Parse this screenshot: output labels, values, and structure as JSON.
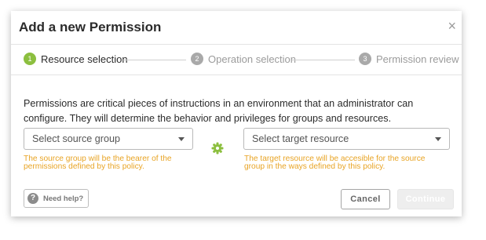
{
  "modal": {
    "title": "Add a new Permission",
    "close_symbol": "×"
  },
  "stepper": {
    "steps": [
      {
        "number": "1",
        "label": "Resource selection",
        "state": "active"
      },
      {
        "number": "2",
        "label": "Operation selection",
        "state": "inactive"
      },
      {
        "number": "3",
        "label": "Permission review",
        "state": "inactive"
      }
    ]
  },
  "description": "Permissions are critical pieces of instructions in an environment that an administrator can configure. They will determine the behavior and privileges for groups and resources.",
  "source": {
    "placeholder": "Select source group",
    "hint_line1": "The source group will be the bearer of the",
    "hint_line2": "permissions defined by this policy."
  },
  "target": {
    "placeholder": "Select target resource",
    "hint_line1": "The target resource will be accesible for the source",
    "hint_line2": "group in the ways defined by this policy."
  },
  "footer": {
    "help_icon": "?",
    "help_label": "Need help?",
    "cancel_label": "Cancel",
    "continue_label": "Continue"
  },
  "colors": {
    "accent_green": "#8cbf3f",
    "hint_orange": "#e8a425",
    "inactive_grey": "#a9a9a9"
  },
  "icons": {
    "close": "close-icon",
    "gear": "gear-icon",
    "caret": "chevron-down-icon",
    "help": "question-icon"
  }
}
